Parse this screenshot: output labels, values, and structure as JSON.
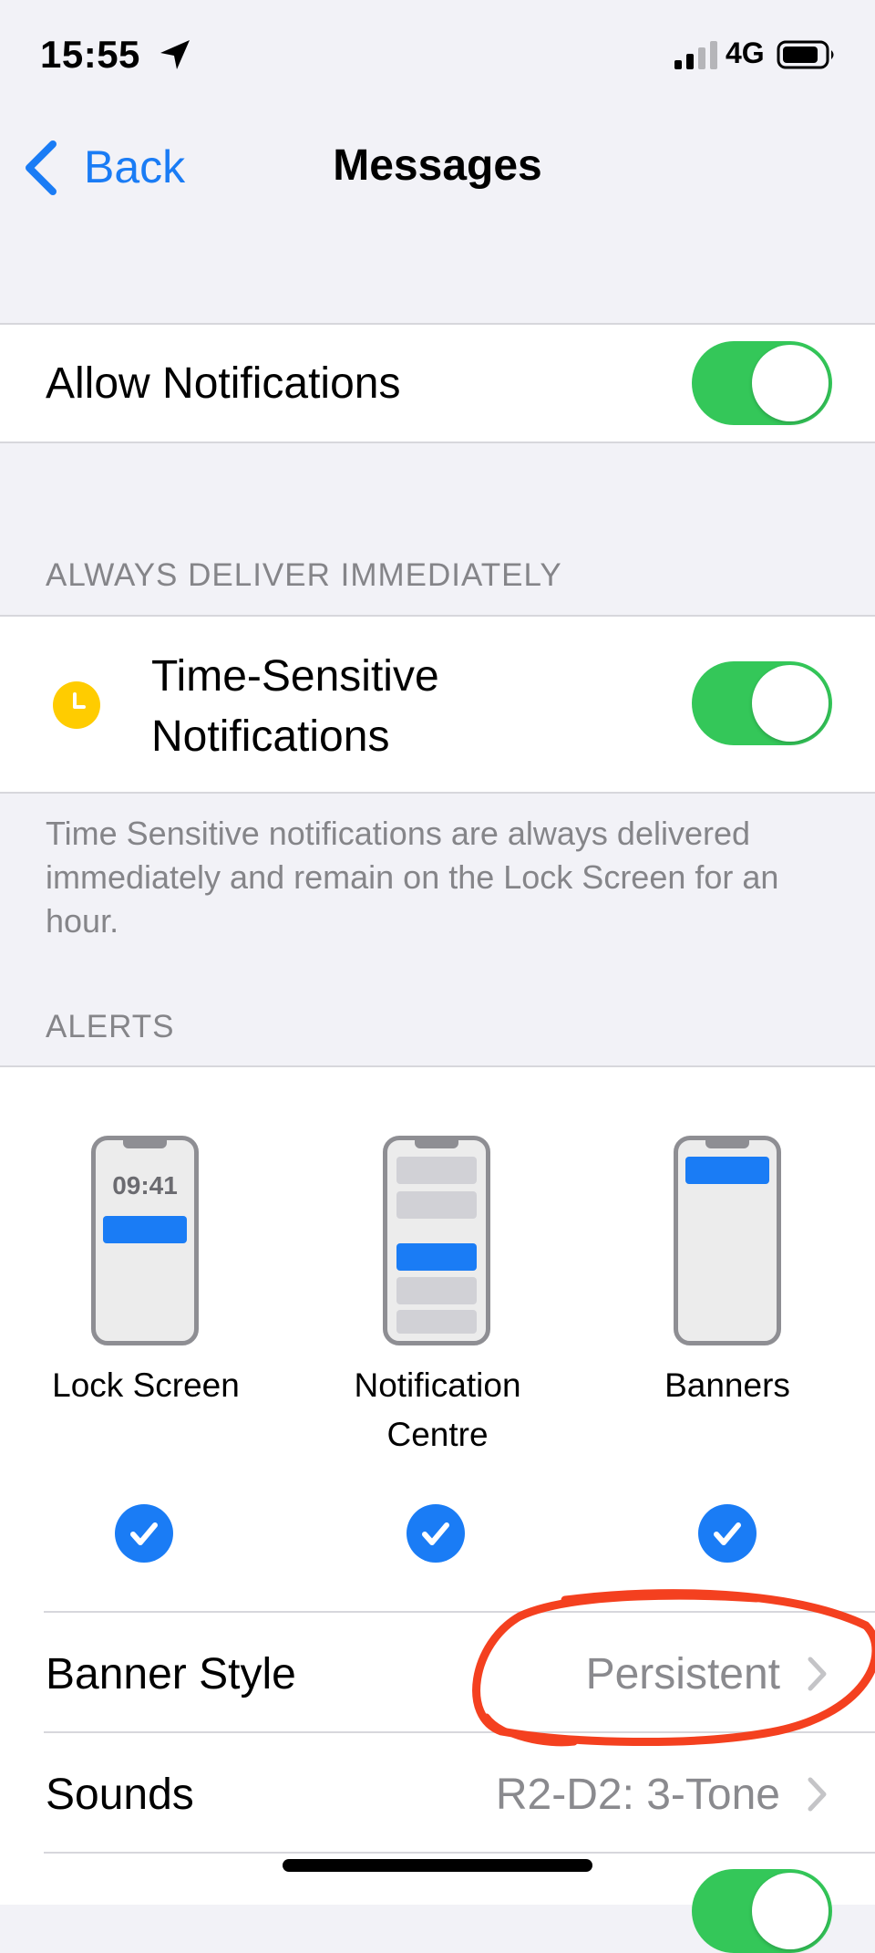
{
  "status_bar": {
    "time": "15:55",
    "network": "4G"
  },
  "nav": {
    "back_label": "Back",
    "title": "Messages"
  },
  "allow_notifications": {
    "label": "Allow Notifications",
    "enabled": true
  },
  "always_deliver": {
    "header": "ALWAYS DELIVER IMMEDIATELY",
    "time_sensitive_line1": "Time-Sensitive",
    "time_sensitive_line2": "Notifications",
    "enabled": true,
    "footnote": "Time Sensitive notifications are always delivered immediately and remain on the Lock Screen for an hour."
  },
  "alerts": {
    "header": "ALERTS",
    "lock_screen_time": "09:41",
    "options": [
      {
        "label": "Lock Screen",
        "checked": true
      },
      {
        "label_line1": "Notification",
        "label_line2": "Centre",
        "checked": true
      },
      {
        "label": "Banners",
        "checked": true
      }
    ]
  },
  "banner_style": {
    "label": "Banner Style",
    "value": "Persistent"
  },
  "sounds": {
    "label": "Sounds",
    "value": "R2-D2: 3-Tone"
  },
  "colors": {
    "accent": "#1a7cf5",
    "toggle_on": "#34c759",
    "annotation": "#f4401f",
    "clock_icon": "#ffcc00"
  }
}
